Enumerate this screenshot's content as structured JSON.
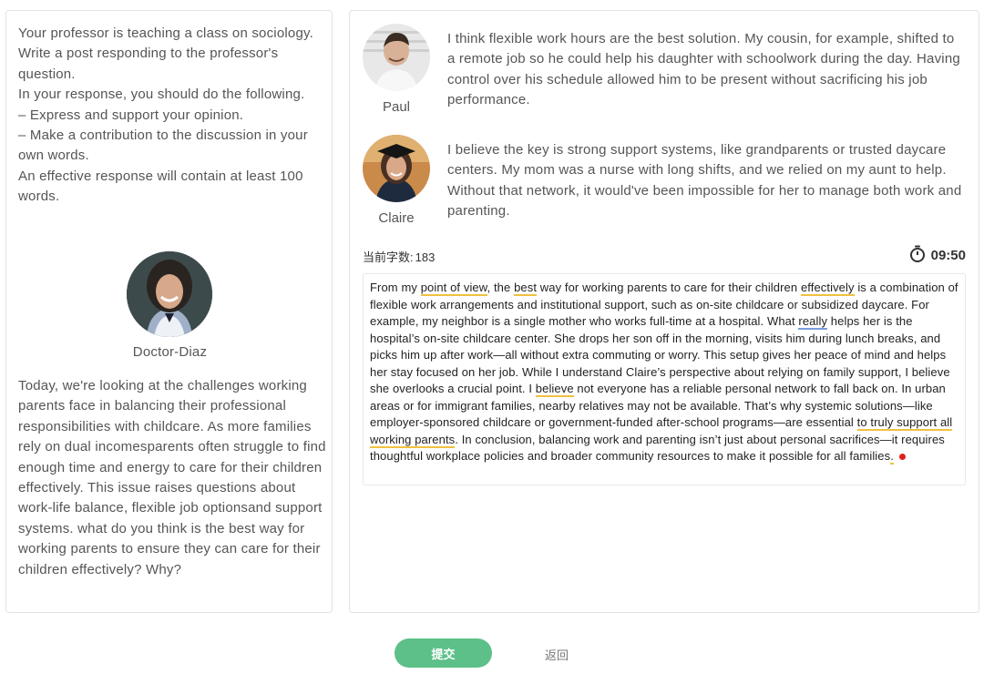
{
  "prompt": {
    "lines": [
      "Your professor is teaching a class on sociology. Write a post responding to the professor's question.",
      "In your response, you should do the following.",
      "– Express and support your opinion.",
      "– Make a contribution to the discussion in your own words.",
      "An effective response will contain at least 100 words."
    ]
  },
  "professor": {
    "name": "Doctor-Diaz",
    "question": "Today, we're looking at the challenges working parents face in balancing their professional responsibilities with childcare. As more families rely on dual incomesparents often struggle to find enough time and energy to care for their children effectively. This issue raises questions about work-life balance, flexible job optionsand support systems. what do you think is the best way for working parents to ensure they can care for their children effectively? Why?"
  },
  "students": [
    {
      "name": "Paul",
      "post": "I think flexible work hours are the best solution. My cousin, for example, shifted to a remote job so he could help his daughter with schoolwork during the day. Having control over his schedule allowed him to be present without sacrificing his job performance."
    },
    {
      "name": "Claire",
      "post": "I believe the key is strong support systems, like grandparents or trusted daycare centers. My mom was a nurse with long shifts, and we relied on my aunt to help. Without that network, it would've been impossible for her to manage both work and parenting."
    }
  ],
  "editor": {
    "word_count_label": "当前字数:",
    "word_count": "183",
    "timer": "09:50",
    "segments": [
      "From my ",
      "point of view",
      ", the ",
      "best",
      " way for working parents to care for their children ",
      "effectively",
      " is a combination of flexible work arrangements and institutional support, such as on-site childcare or subsidized daycare. For example, my neighbor is a single mother who works full-time at a hospital. What ",
      "really",
      " helps her is the hospital’s on-site childcare center. She drops her son off in the morning, visits him during lunch breaks, and picks him up after work—all without extra commuting or worry. This setup gives her peace of mind and helps her stay focused on her job. While I understand Claire’s perspective about relying on family support, I ",
      "believe",
      " she overlooks a crucial point. I ",
      "believe",
      " not everyone has a reliable personal network to fall back on. In urban areas or for immigrant families, nearby relatives may not be available. That’s why systemic solutions—like employer-sponsored childcare or government-funded after-school programs—are essential ",
      "to truly support all working parents",
      ". In conclusion, balancing work and parenting isn’t just about personal sacrifices—it requires thoughtful workplace policies and broader community resources to make it possible for all families",
      "."
    ]
  },
  "actions": {
    "submit_label": "提交",
    "back_label": "返回"
  },
  "colors": {
    "submit_green": "#5cc088",
    "underline_yellow": "#f0c040",
    "underline_blue": "#7a9de0",
    "error_red": "#e02020"
  }
}
